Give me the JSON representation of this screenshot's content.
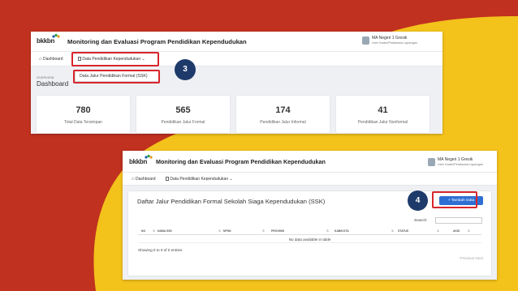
{
  "window1": {
    "logo_text": "bkkbn",
    "app_title": "Monitoring dan Evaluasi Program Pendidikan Kependudukan",
    "user_name": "MA Negeri 1 Gresik",
    "user_role": "User Kader/Pelaksana Lapangan",
    "nav_dashboard": "Dashboard",
    "nav_data": "Data Pendidikan Kependudukan",
    "dropdown_item": "Data Jalur Pendidikan Formal (SSK)",
    "overview_label": "OVERVIEW",
    "heading": "Dashboard",
    "step_number": "3",
    "cards": [
      {
        "value": "780",
        "label": "Total Data Tersimpan"
      },
      {
        "value": "565",
        "label": "Pendidikan Jalur Formal"
      },
      {
        "value": "174",
        "label": "Pendidikan Jalur Informal"
      },
      {
        "value": "41",
        "label": "Pendidikan Jalur Nonformal"
      }
    ]
  },
  "window2": {
    "logo_text": "bkkbn",
    "app_title": "Monitoring dan Evaluasi Program Pendidikan Kependudukan",
    "user_name": "MA Negeri 1 Gresik",
    "user_role": "User Kader/Pelaksana Lapangan",
    "nav_dashboard": "Dashboard",
    "nav_data": "Data Pendidikan Kependudukan",
    "panel_title": "Daftar Jalur Pendidikan Formal Sekolah Siaga Kependudukan (SSK)",
    "add_button": "Tambah Data",
    "step_number": "4",
    "search_label": "Search:",
    "columns": [
      "NO",
      "NAMA SSK",
      "NPSN",
      "PROVINSI",
      "KAB/KOTA",
      "STATUS",
      "AKSI"
    ],
    "empty_text": "No data available in table",
    "info_text": "Showing 0 to 0 of 0 entries",
    "pager_text": "Previous  Next"
  },
  "colors": {
    "background_yellow": "#f3c21b",
    "background_red": "#c0311f",
    "highlight_red": "#d8262c",
    "primary_blue": "#2f6fd3",
    "step_badge": "#1e3a6b"
  }
}
